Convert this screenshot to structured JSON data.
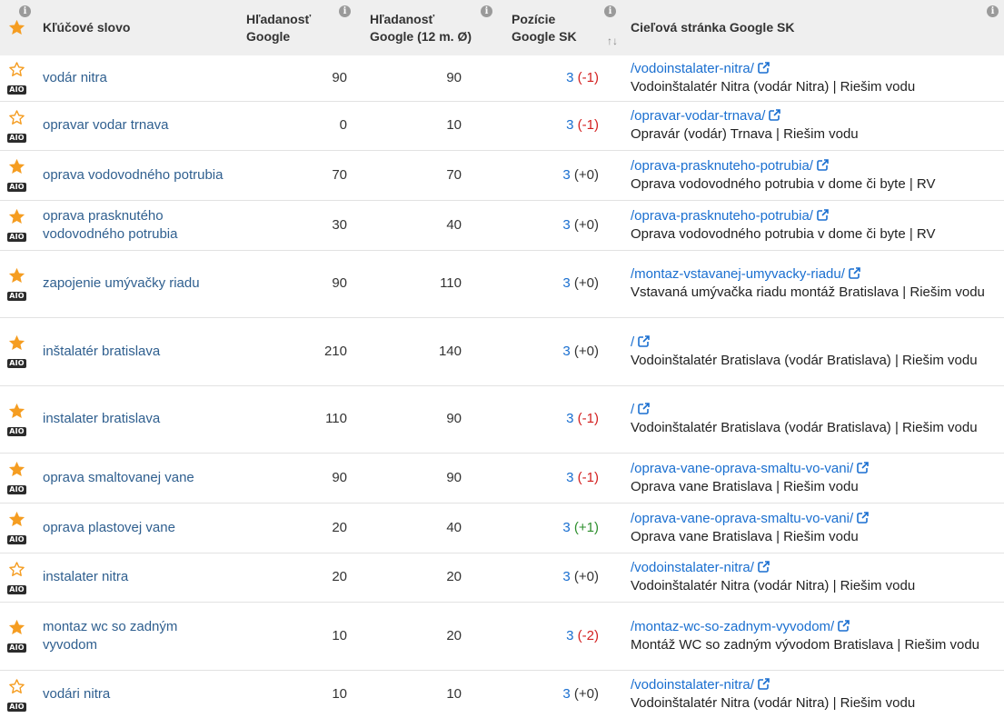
{
  "header": {
    "keyword": "Kľúčové slovo",
    "sv_google_1": "Hľadanosť",
    "sv_google_2": "Google",
    "sv12_1": "Hľadanosť",
    "sv12_2": "Google (12 m. Ø)",
    "pos_1": "Pozície",
    "pos_2": "Google SK",
    "url": "Cieľová stránka Google SK",
    "info": "i",
    "sort": "↑↓"
  },
  "colors": {
    "star": "#f59d21",
    "link": "#1a6fd0",
    "keyword": "#2f5f8f",
    "negative": "#d32020",
    "positive": "#2e8f2e"
  },
  "rows": [
    {
      "starred": false,
      "aio": "AIO",
      "keyword": "vodár nitra",
      "sv": "90",
      "sv12": "90",
      "pos": "3",
      "delta": "(-1)",
      "url": "/vodoinstalater-nitra/",
      "title": "Vodoinštalatér Nitra (vodár Nitra) | Riešim vodu"
    },
    {
      "starred": false,
      "aio": "AIO",
      "keyword": "opravar vodar trnava",
      "sv": "0",
      "sv12": "10",
      "pos": "3",
      "delta": "(-1)",
      "url": "/opravar-vodar-trnava/",
      "title": "Opravár (vodár) Trnava | Riešim vodu"
    },
    {
      "starred": true,
      "aio": "AIO",
      "keyword": "oprava vodovodného potrubia",
      "sv": "70",
      "sv12": "70",
      "pos": "3",
      "delta": "(+0)",
      "url": "/oprava-prasknuteho-potrubia/",
      "title": "Oprava vodovodného potrubia v dome či byte | RV"
    },
    {
      "starred": true,
      "aio": "AIO",
      "keyword": "oprava prasknutého vodovodného potrubia",
      "sv": "30",
      "sv12": "40",
      "pos": "3",
      "delta": "(+0)",
      "url": "/oprava-prasknuteho-potrubia/",
      "title": "Oprava vodovodného potrubia v dome či byte | RV"
    },
    {
      "starred": true,
      "aio": "AIO",
      "keyword": "zapojenie umývačky riadu",
      "sv": "90",
      "sv12": "110",
      "pos": "3",
      "delta": "(+0)",
      "url": "/montaz-vstavanej-umyvacky-riadu/",
      "title": "Vstavaná umývačka riadu montáž Bratislava | Riešim vodu"
    },
    {
      "starred": true,
      "aio": "AIO",
      "keyword": "inštalatér bratislava",
      "sv": "210",
      "sv12": "140",
      "pos": "3",
      "delta": "(+0)",
      "url": "/",
      "title": "Vodoinštalatér Bratislava (vodár Bratislava) | Riešim vodu"
    },
    {
      "starred": true,
      "aio": "AIO",
      "keyword": "instalater bratislava",
      "sv": "110",
      "sv12": "90",
      "pos": "3",
      "delta": "(-1)",
      "url": "/",
      "title": "Vodoinštalatér Bratislava (vodár Bratislava) | Riešim vodu"
    },
    {
      "starred": true,
      "aio": "AIO",
      "keyword": "oprava smaltovanej vane",
      "sv": "90",
      "sv12": "90",
      "pos": "3",
      "delta": "(-1)",
      "url": "/oprava-vane-oprava-smaltu-vo-vani/",
      "title": "Oprava vane Bratislava | Riešim vodu"
    },
    {
      "starred": true,
      "aio": "AIO",
      "keyword": "oprava plastovej vane",
      "sv": "20",
      "sv12": "40",
      "pos": "3",
      "delta": "(+1)",
      "url": "/oprava-vane-oprava-smaltu-vo-vani/",
      "title": "Oprava vane Bratislava | Riešim vodu"
    },
    {
      "starred": false,
      "aio": "AIO",
      "keyword": "instalater nitra",
      "sv": "20",
      "sv12": "20",
      "pos": "3",
      "delta": "(+0)",
      "url": "/vodoinstalater-nitra/",
      "title": "Vodoinštalatér Nitra (vodár Nitra) | Riešim vodu"
    },
    {
      "starred": true,
      "aio": "AIO",
      "keyword": "montaz wc so zadným vyvodom",
      "sv": "10",
      "sv12": "20",
      "pos": "3",
      "delta": "(-2)",
      "url": "/montaz-wc-so-zadnym-vyvodom/",
      "title": "Montáž WC so zadným vývodom Bratislava | Riešim vodu"
    },
    {
      "starred": false,
      "aio": "AIO",
      "keyword": "vodári nitra",
      "sv": "10",
      "sv12": "10",
      "pos": "3",
      "delta": "(+0)",
      "url": "/vodoinstalater-nitra/",
      "title": "Vodoinštalatér Nitra (vodár Nitra) | Riešim vodu"
    }
  ]
}
